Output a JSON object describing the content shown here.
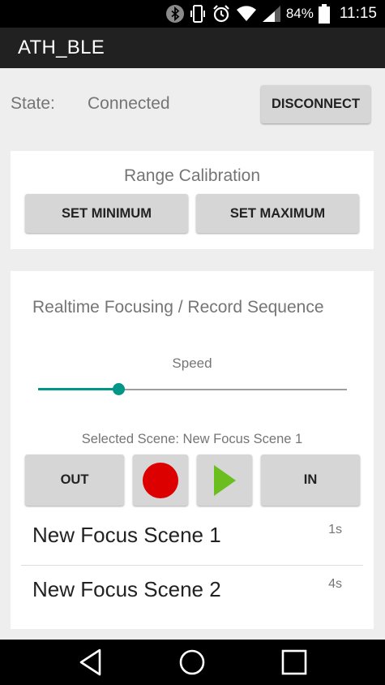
{
  "status_bar": {
    "battery_percent": "84%",
    "time": "11:15",
    "icons": [
      "bluetooth-icon",
      "vibrate-icon",
      "alarm-icon",
      "wifi-icon",
      "signal-icon",
      "battery-icon"
    ]
  },
  "app": {
    "title": "ATH_BLE"
  },
  "connection": {
    "state_label": "State:",
    "state_value": "Connected",
    "disconnect_label": "DISCONNECT"
  },
  "range_calibration": {
    "title": "Range Calibration",
    "set_minimum_label": "SET MINIMUM",
    "set_maximum_label": "SET MAXIMUM"
  },
  "focus": {
    "title": "Realtime Focusing / Record Sequence",
    "speed_label": "Speed",
    "speed_value": 0.26,
    "selected_scene": "Selected Scene: New Focus Scene 1",
    "out_label": "OUT",
    "in_label": "IN",
    "record_color": "#dd0000",
    "play_color": "#6abf1f",
    "accent_color": "#009688",
    "scenes": [
      {
        "name": "New Focus Scene 1",
        "duration": "1s"
      },
      {
        "name": "New Focus Scene 2",
        "duration": "4s"
      }
    ]
  },
  "nav_bar": {
    "icons": [
      "back-icon",
      "home-icon",
      "recents-icon"
    ]
  }
}
